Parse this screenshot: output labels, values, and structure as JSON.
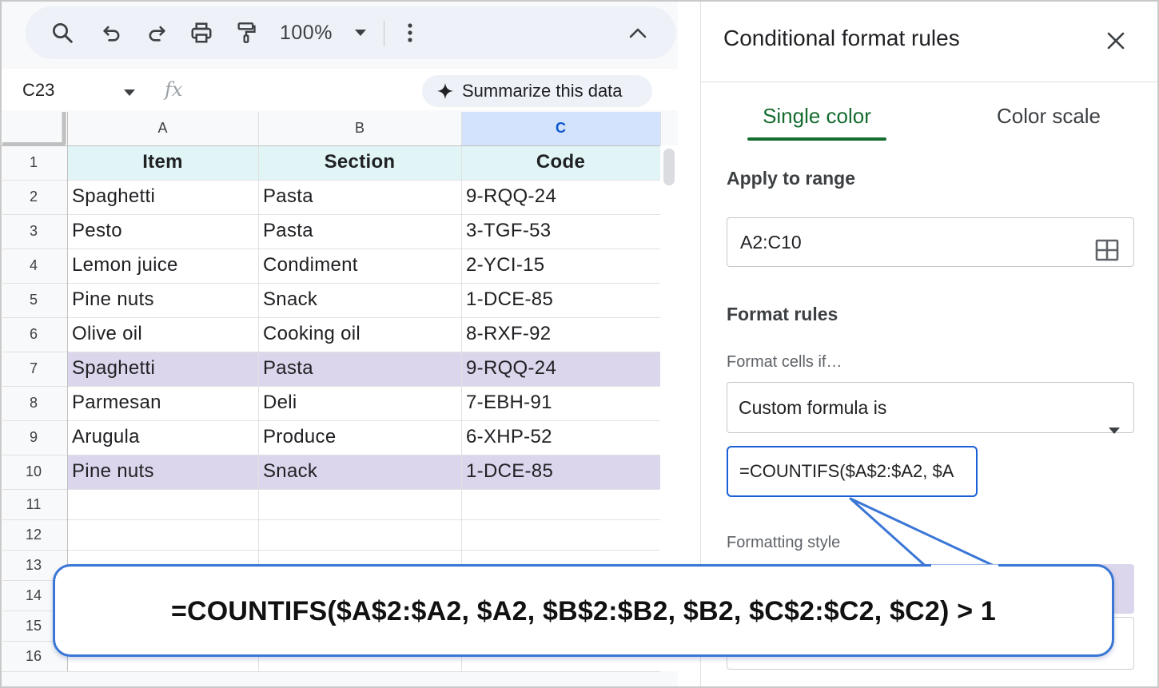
{
  "toolbar": {
    "zoom": "100%",
    "icons": [
      "search-icon",
      "undo-icon",
      "redo-icon",
      "print-icon",
      "paint-format-icon",
      "chevron-down-icon",
      "more-vert-icon",
      "chevron-up-icon"
    ]
  },
  "formula_bar": {
    "name_box": "C23",
    "fx": "fx",
    "summarize_label": "Summarize this data"
  },
  "sheet": {
    "columns": [
      "A",
      "B",
      "C"
    ],
    "selected_column": "C",
    "row_numbers": [
      "1",
      "2",
      "3",
      "4",
      "5",
      "6",
      "7",
      "8",
      "9",
      "10",
      "11",
      "12",
      "13",
      "14",
      "15",
      "16"
    ],
    "header": [
      "Item",
      "Section",
      "Code"
    ],
    "rows": [
      [
        "Spaghetti",
        "Pasta",
        "9-RQQ-24"
      ],
      [
        "Pesto",
        "Pasta",
        "3-TGF-53"
      ],
      [
        "Lemon juice",
        "Condiment",
        "2-YCI-15"
      ],
      [
        "Pine nuts",
        "Snack",
        "1-DCE-85"
      ],
      [
        "Olive oil",
        "Cooking oil",
        "8-RXF-92"
      ],
      [
        "Spaghetti",
        "Pasta",
        "9-RQQ-24"
      ],
      [
        "Parmesan",
        "Deli",
        "7-EBH-91"
      ],
      [
        "Arugula",
        "Produce",
        "6-XHP-52"
      ],
      [
        "Pine nuts",
        "Snack",
        "1-DCE-85"
      ]
    ],
    "highlighted_rows": [
      7,
      10
    ],
    "colors": {
      "header_fill": "#e1f5f7",
      "highlight_fill": "#dcd6ec",
      "selected_col_fill": "#d3e3fd"
    }
  },
  "panel": {
    "title": "Conditional format rules",
    "tabs": [
      {
        "label": "Single color",
        "active": true
      },
      {
        "label": "Color scale",
        "active": false
      }
    ],
    "apply_to_range_label": "Apply to range",
    "range_value": "A2:C10",
    "format_rules_label": "Format rules",
    "format_cells_if_label": "Format cells if…",
    "condition_value": "Custom formula is",
    "formula_value": "=COUNTIFS($A$2:$A2, $A",
    "formatting_style_label": "Formatting style",
    "accent_color": "#146c2e"
  },
  "callout": {
    "text": "=COUNTIFS($A$2:$A2, $A2, $B$2:$B2, $B2, $C$2:$C2, $C2) > 1",
    "border_color": "#3a76d6"
  }
}
